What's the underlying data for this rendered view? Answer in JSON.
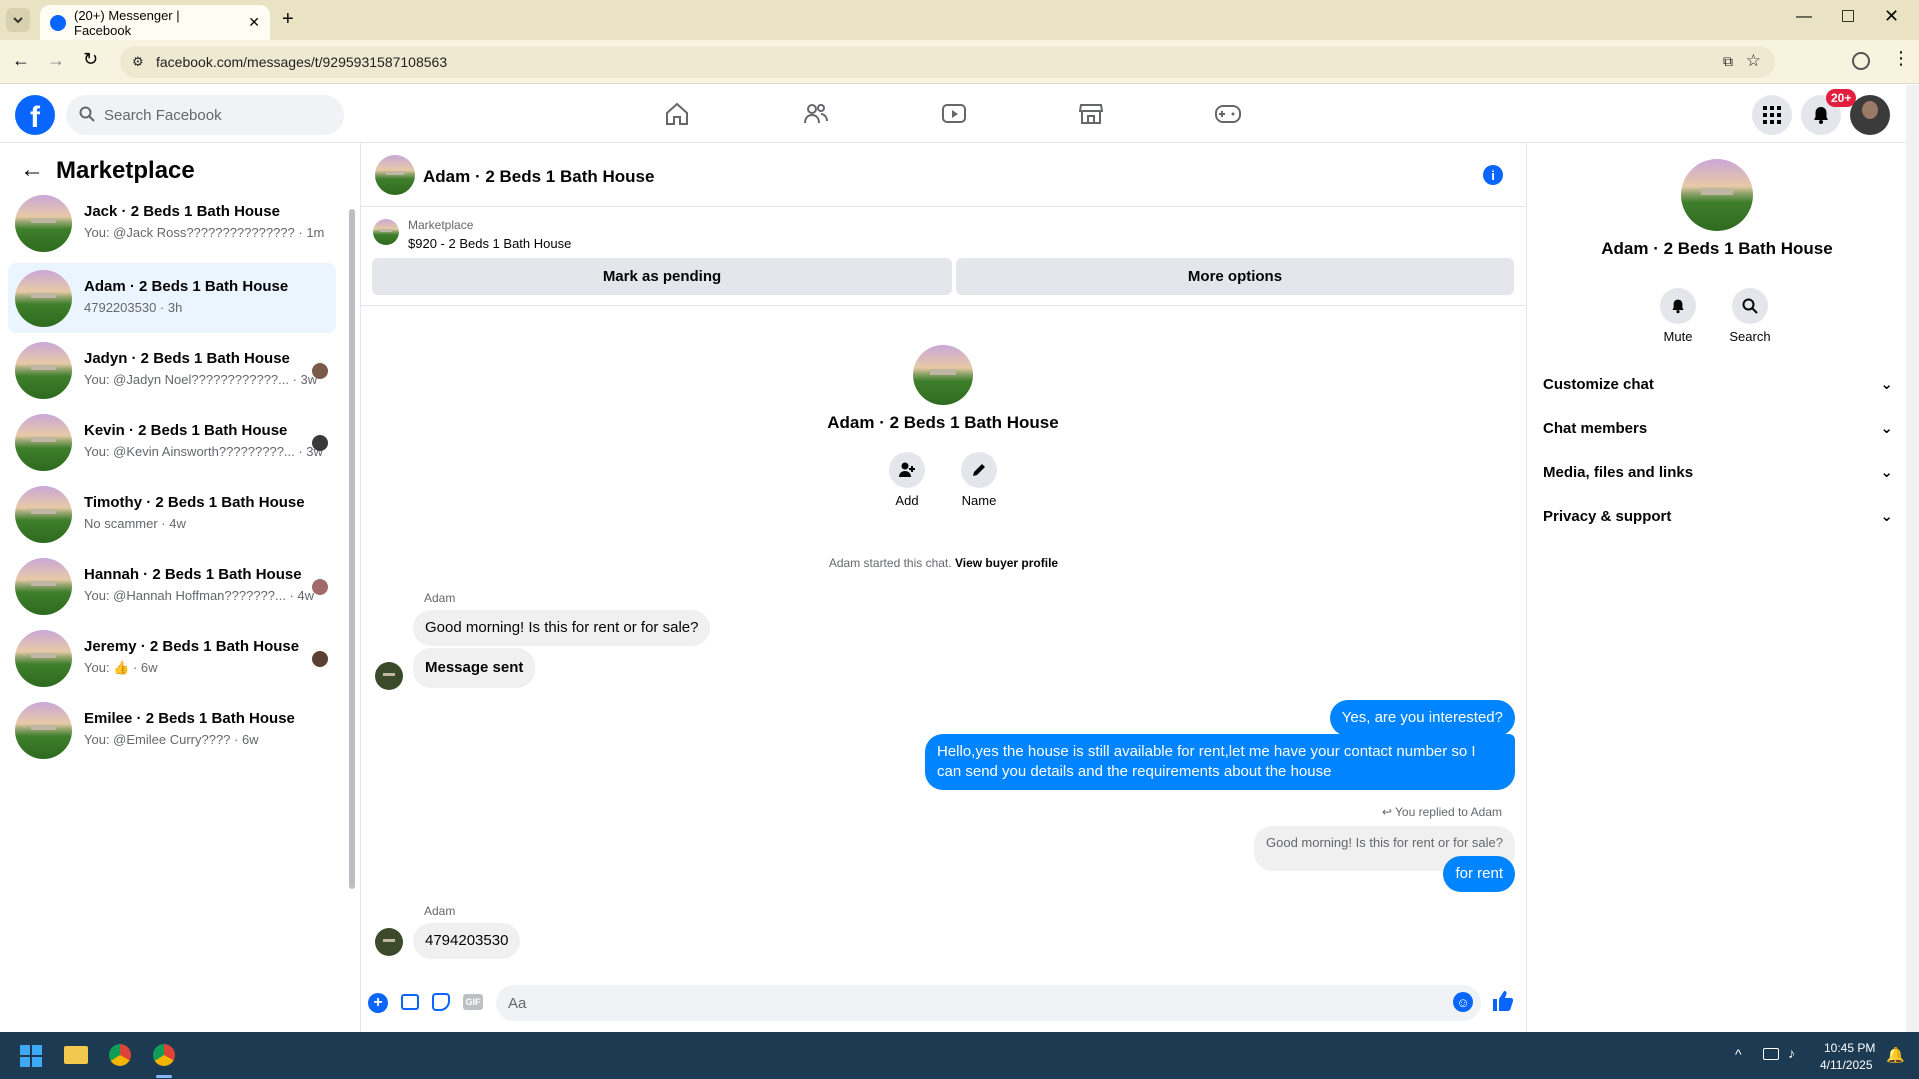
{
  "browser": {
    "tab_title": "(20+) Messenger | Facebook",
    "url": "facebook.com/messages/t/9295931587108563"
  },
  "fb": {
    "search_placeholder": "Search Facebook",
    "notif_badge": "20+"
  },
  "left": {
    "title": "Marketplace",
    "conversations": [
      {
        "name": "Jack · 2 Beds 1 Bath House",
        "preview": "You: @Jack Ross??????????????? · 1m"
      },
      {
        "name": "Adam · 2 Beds 1 Bath House",
        "preview": "4792203530 · 3h"
      },
      {
        "name": "Jadyn · 2 Beds 1 Bath House",
        "preview": "You: @Jadyn Noel????????????... · 3w"
      },
      {
        "name": "Kevin · 2 Beds 1 Bath House",
        "preview": "You: @Kevin Ainsworth?????????... · 3w"
      },
      {
        "name": "Timothy · 2 Beds 1 Bath House",
        "preview": "No scammer · 4w"
      },
      {
        "name": "Hannah · 2 Beds 1 Bath House",
        "preview": "You: @Hannah Hoffman???????... · 4w"
      },
      {
        "name": "Jeremy · 2 Beds 1 Bath House",
        "preview": "You: 👍 · 6w"
      },
      {
        "name": "Emilee · 2 Beds 1 Bath House",
        "preview": "You: @Emilee Curry???? · 6w"
      }
    ]
  },
  "chat": {
    "header_title": "Adam · 2 Beds 1 Bath House",
    "listing_source": "Marketplace",
    "listing_title": "$920 - 2 Beds 1 Bath House",
    "mark_pending": "Mark as pending",
    "more_options": "More options",
    "profile_name": "Adam · 2 Beds 1 Bath House",
    "add_label": "Add",
    "name_label": "Name",
    "started_text": "Adam started this chat.",
    "buyer_profile_link": "View buyer profile",
    "sender1": "Adam",
    "msg1": "Good morning! Is this for rent or for sale?",
    "msg2": "Message sent",
    "msg3": "Yes, are you interested?",
    "msg4": "Hello,yes the house is still available for rent,let me have your contact number   so I can send you details and the requirements about the house",
    "replied_label": "You replied to Adam",
    "quoted": "Good morning! Is this for rent or for sale?",
    "msg5": "for rent",
    "sender2": "Adam",
    "msg6": "4794203530",
    "composer_placeholder": "Aa"
  },
  "right": {
    "name": "Adam · 2 Beds 1 Bath House",
    "mute": "Mute",
    "search": "Search",
    "sections": [
      "Customize chat",
      "Chat members",
      "Media, files and links",
      "Privacy & support"
    ]
  },
  "taskbar": {
    "time": "10:45 PM",
    "date": "4/11/2025"
  },
  "colors": {
    "accent": "#0084ff",
    "fb_blue": "#0866ff",
    "badge": "#e41e3f"
  }
}
